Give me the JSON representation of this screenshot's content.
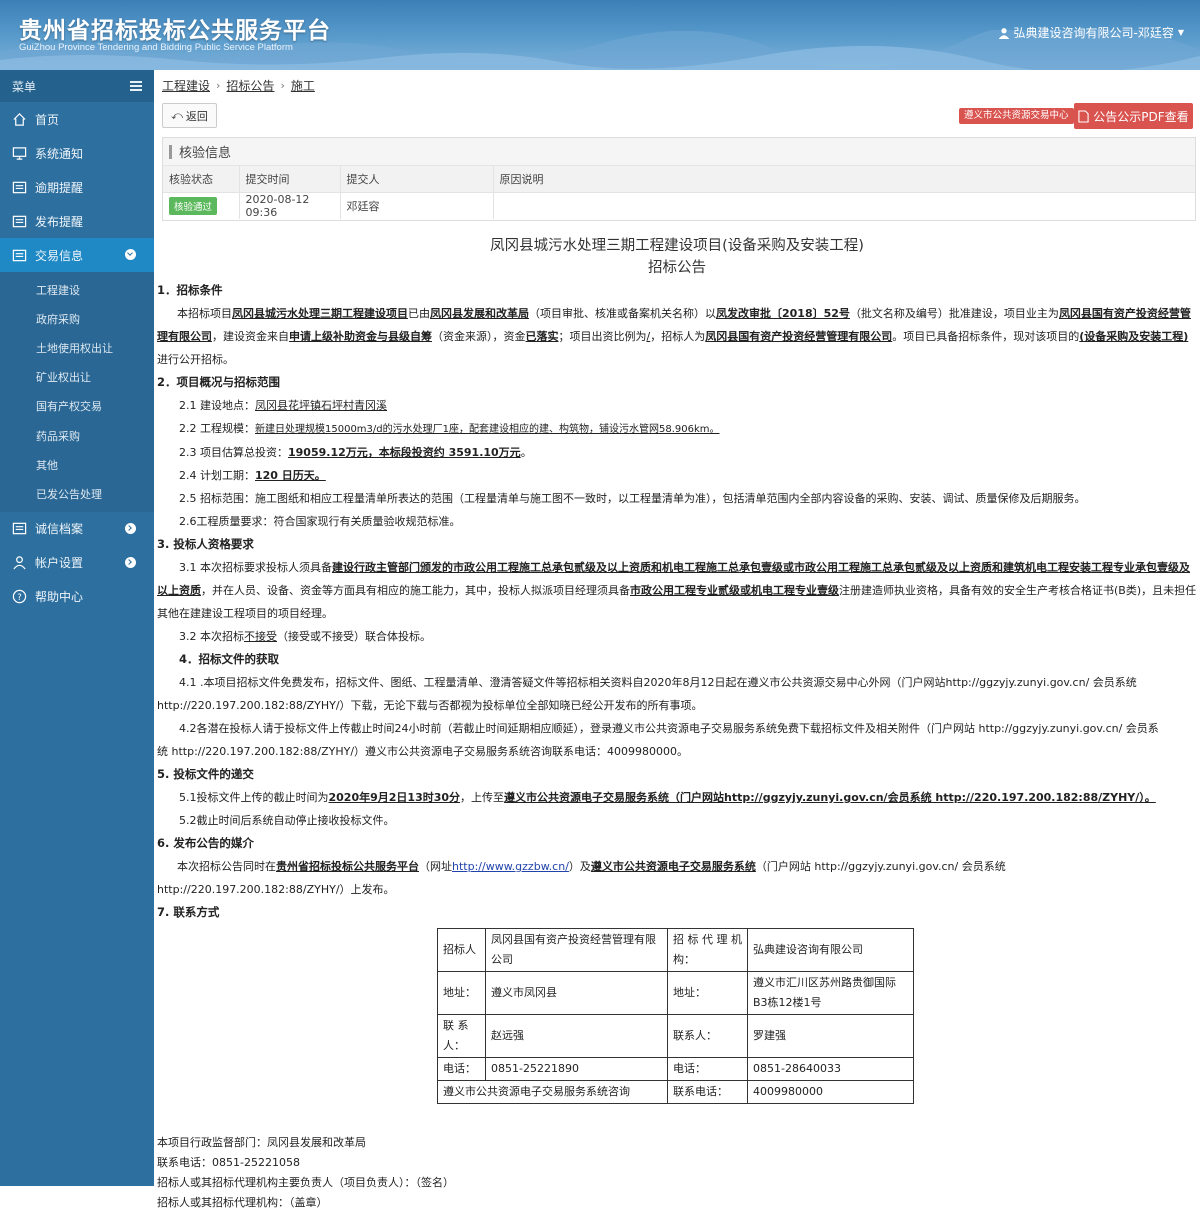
{
  "header": {
    "title": "贵州省招标投标公共服务平台",
    "subtitle": "GuiZhou Province Tendering and Bidding Public Service Platform",
    "user": "弘典建设咨询有限公司-邓廷容"
  },
  "sidebar": {
    "menu_label": "菜单",
    "items": [
      {
        "label": "首页"
      },
      {
        "label": "系统通知"
      },
      {
        "label": "逾期提醒"
      },
      {
        "label": "发布提醒"
      },
      {
        "label": "交易信息"
      }
    ],
    "sub_items": [
      "工程建设",
      "政府采购",
      "土地使用权出让",
      "矿业权出让",
      "国有产权交易",
      "药品采购",
      "其他",
      "已发公告处理"
    ],
    "items_after": [
      {
        "label": "诚信档案"
      },
      {
        "label": "帐户设置"
      },
      {
        "label": "帮助中心"
      }
    ]
  },
  "breadcrumb": [
    "工程建设",
    "招标公告",
    "施工"
  ],
  "toolbar": {
    "back": "返回",
    "center_btn": "遵义市公共资源交易中心",
    "pdf_btn": "公告公示PDF查看"
  },
  "verify": {
    "title": "核验信息",
    "headers": [
      "核验状态",
      "提交时间",
      "提交人",
      "原因说明"
    ],
    "status": "核验通过",
    "time": "2020-08-12 09:36",
    "person": "邓廷容",
    "reason": ""
  },
  "doc": {
    "title1": "凤冈县城污水处理三期工程建设项目(设备采购及安装工程)",
    "title2": "招标公告",
    "s1": "1．招标条件",
    "s1_p": [
      "本招标项目",
      "凤冈县城污水处理三期工程建设项目",
      "已由",
      "凤冈县发展和改革局",
      "（项目审批、核准或备案机关名称）以",
      "凤发改审批〔2018〕52号",
      "（批文名称及编号）批准建设，项目业主为",
      "凤冈县国有资产投资经营管理有限公司",
      "，建设资金来自",
      "申请上级补助资金与县级自筹",
      "（资金来源），资金",
      "已落实",
      "；项目出资比例为",
      "/",
      "，招标人为",
      "凤冈县国有资产投资经营管理有限公司",
      "。项目已具备招标条件，现对该项目的",
      "(设备采购及安装工程)",
      "进行公开招标。"
    ],
    "s2": "2．项目概况与招标范围",
    "s2_1": [
      "2.1 建设地点：",
      "凤冈县花坪镇石坪村青冈溪"
    ],
    "s2_2": [
      "2.2 工程规模：",
      "新建日处理规模15000m3/d的污水处理厂1座，配套建设相应的建、构筑物，铺设污水管网58.906km。"
    ],
    "s2_3": [
      "2.3 项目估算总投资：",
      "19059.12万元，本标段投资约 3591.10万元",
      "。"
    ],
    "s2_4": [
      "2.4 计划工期：",
      "120 日历天。"
    ],
    "s2_5": "2.5 招标范围：施工图纸和相应工程量清单所表达的范围（工程量清单与施工图不一致时，以工程量清单为准），包括清单范围内全部内容设备的采购、安装、调试、质量保修及后期服务。",
    "s2_6": "2.6工程质量要求：符合国家现行有关质量验收规范标准。",
    "s3": "3. 投标人资格要求",
    "s3_1": [
      "3.1 本次招标要求投标人须具备",
      "建设行政主管部门颁发的市政公用工程施工总承包贰级及以上资质和机电工程施工总承包壹级或市政公用工程施工总承包贰级及以上资质和建筑机电工程安装工程专业承包壹级及以上资质",
      "，并在人员、设备、资金等方面具有相应的施工能力，其中，投标人拟派项目经理须具备",
      "市政公用工程专业贰级或机电工程专业壹级",
      "注册建造师执业资格，具备有效的安全生产考核合格证书(B类)，且未担任其他在建建设工程项目的项目经理。"
    ],
    "s3_2": [
      "3.2 本次招标",
      "不接受",
      "（接受或不接受）联合体投标。"
    ],
    "s4": "4．招标文件的获取",
    "s4_1": "4.1 .本项目招标文件免费发布，招标文件、图纸、工程量清单、澄清答疑文件等招标相关资料自2020年8月12日起在遵义市公共资源交易中心外网（门户网站http://ggzyjy.zunyi.gov.cn/ 会员系统 http://220.197.200.182:88/ZYHY/）下载，无论下载与否都视为投标单位全部知晓已经公开发布的所有事项。",
    "s4_2a": "4.2各潜在投标人请于投标文件上传截止时间24小时前（若截止时间延期相应顺延），登录遵义市公共资源电子交易服务系统免费下载招标文件及相关附件（门户网站 http://ggzyjy.zunyi.gov.cn/ 会员系",
    "s4_2b": "统 http://220.197.200.182:88/ZYHY/）遵义市公共资源电子交易服务系统咨询联系电话：4009980000。",
    "s5": "5. 投标文件的递交",
    "s5_1": [
      "5.1投标文件上传的截止时间为",
      "2020年9月2日13时30分",
      "，上传至",
      "遵义市公共资源电子交易服务系统（门户网站http://ggzyjy.zunyi.gov.cn/会员系统 http://220.197.200.182:88/ZYHY/）。"
    ],
    "s5_2": "5.2截止时间后系统自动停止接收投标文件。",
    "s6": "6. 发布公告的媒介",
    "s6_p": [
      "本次招标公告同时在",
      "贵州省招标投标公共服务平台",
      "（网址",
      "http://www.gzzbw.cn/",
      "）及",
      "遵义市公共资源电子交易服务系统",
      "（门户网站 http://ggzyjy.zunyi.gov.cn/ 会员系统 http://220.197.200.182:88/ZYHY/）上发布。"
    ],
    "s7": "7. 联系方式"
  },
  "contact": {
    "r1": [
      "招标人",
      "凤冈县国有资产投资经营管理有限公司",
      "招 标 代 理 机 构：",
      "弘典建设咨询有限公司"
    ],
    "r2": [
      "地址：",
      "遵义市凤冈县",
      "地址：",
      "遵义市汇川区苏州路贵御国际B3栋12楼1号"
    ],
    "r3": [
      "联 系 人：",
      "赵远强",
      "联系人：",
      "罗建强"
    ],
    "r4": [
      "电话：",
      "0851-25221890",
      "电话：",
      "0851-28640033"
    ],
    "r5": [
      "遵义市公共资源电子交易服务系统咨询",
      "联系电话：",
      "4009980000"
    ]
  },
  "footer": [
    "本项目行政监督部门：凤冈县发展和改革局",
    "联系电话：0851-25221058",
    "招标人或其招标代理机构主要负责人（项目负责人）：（签名）",
    "招标人或其招标代理机构：（盖章）"
  ]
}
